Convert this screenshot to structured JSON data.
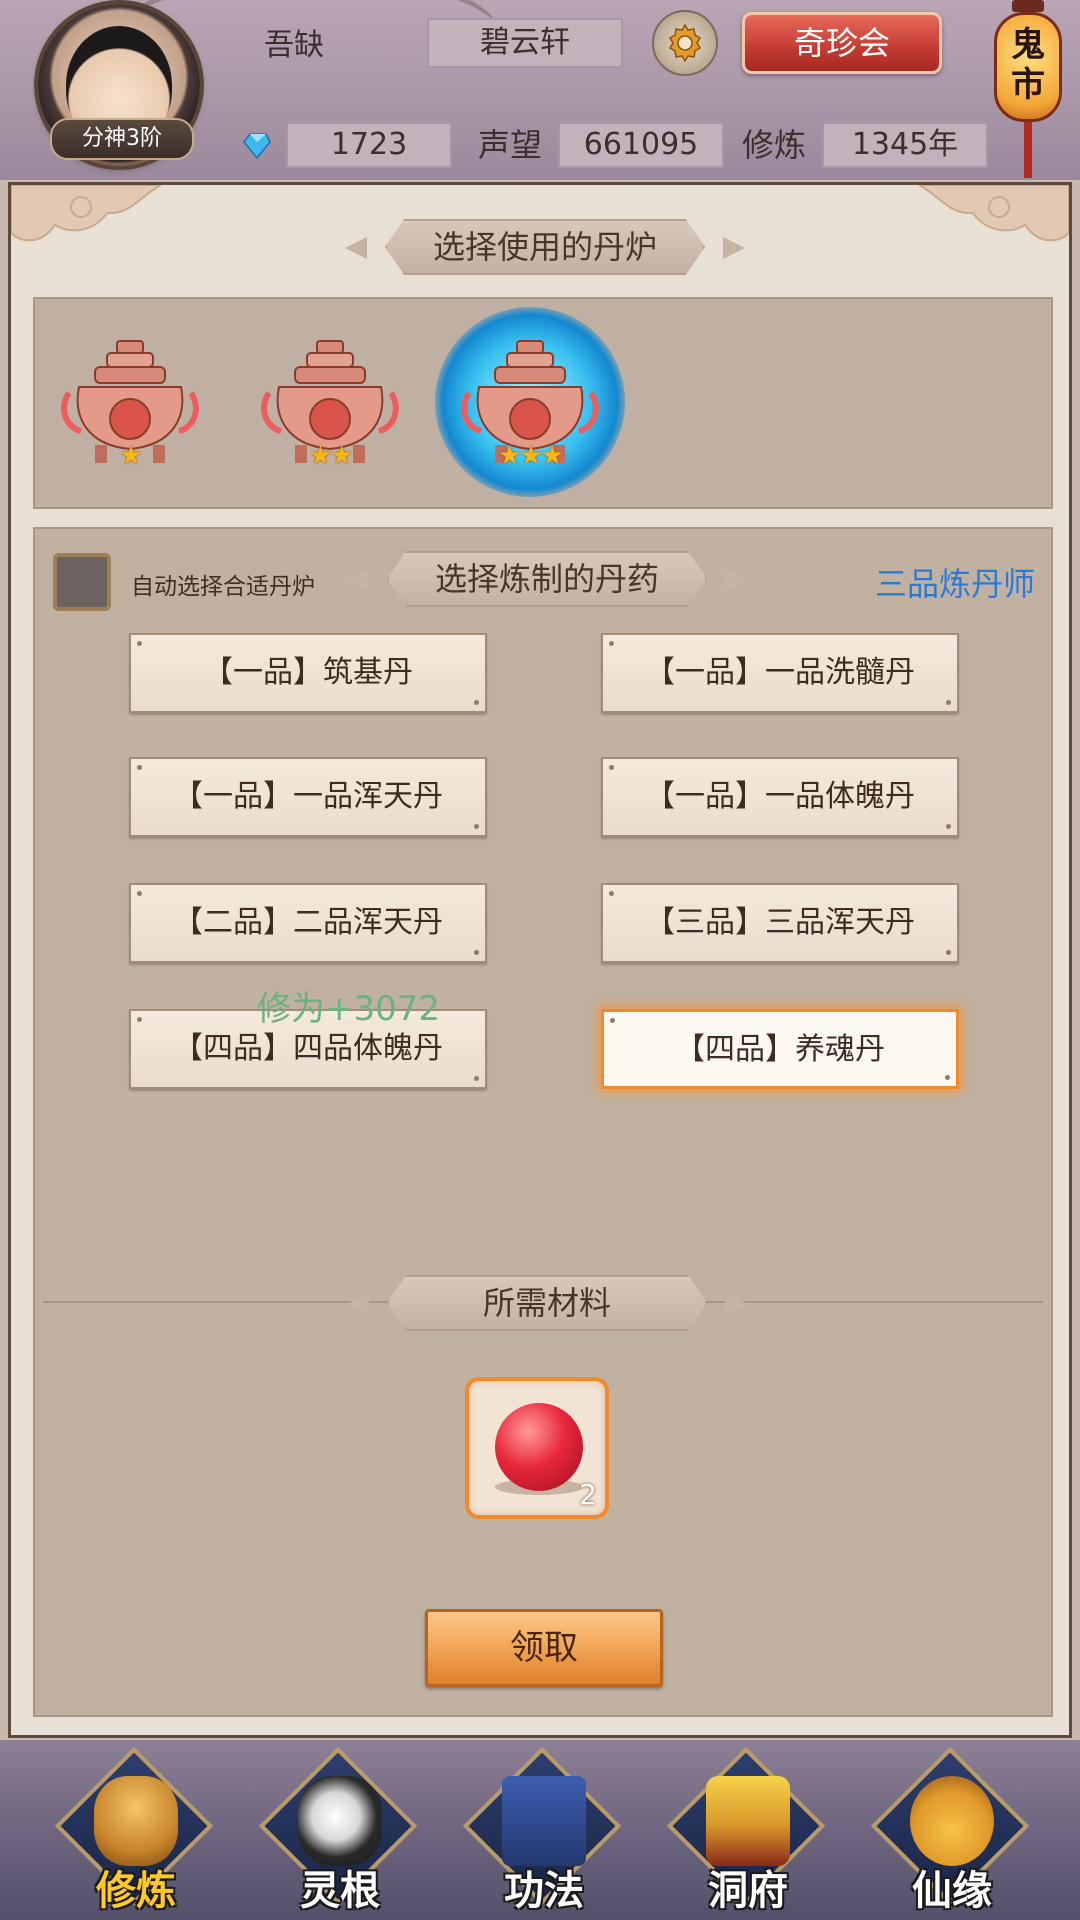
{
  "header": {
    "player_name": "吾缺",
    "realm_badge": "分神3阶",
    "server_name": "碧云轩",
    "treasure_button": "奇珍会",
    "ghost_market_label": "鬼市",
    "stats": {
      "gems": "1723",
      "reputation_label": "声望",
      "reputation": "661095",
      "cultivation_label": "修炼",
      "cultivation": "1345年"
    }
  },
  "furnace_section": {
    "title": "选择使用的丹炉",
    "furnaces": [
      {
        "stars": 1,
        "selected": false
      },
      {
        "stars": 2,
        "selected": false
      },
      {
        "stars": 3,
        "selected": true
      }
    ]
  },
  "pill_section": {
    "title": "选择炼制的丹药",
    "auto_select_label": "自动选择合适丹炉",
    "auto_select_checked": false,
    "alchemist_rank": "三品炼丹师",
    "pills": [
      "【一品】筑基丹",
      "【一品】一品洗髓丹",
      "【一品】一品浑天丹",
      "【一品】一品体魄丹",
      "【二品】二品浑天丹",
      "【三品】三品浑天丹",
      "【四品】四品体魄丹",
      "【四品】养魂丹"
    ],
    "selected_pill": "【四品】养魂丹",
    "floating_gain": "修为+3072"
  },
  "materials_section": {
    "title": "所需材料",
    "material_count": "2",
    "material_icon": "red-orb-icon"
  },
  "claim_button": "领取",
  "bottom_nav": {
    "items": [
      "修炼",
      "灵根",
      "功法",
      "洞府",
      "仙缘"
    ],
    "active": "修炼"
  },
  "colors": {
    "accent_orange": "#f08a2a",
    "rank_blue": "#2a7bd6",
    "gain_green": "#6db27e",
    "nav_active_gold": "#ffc928"
  }
}
